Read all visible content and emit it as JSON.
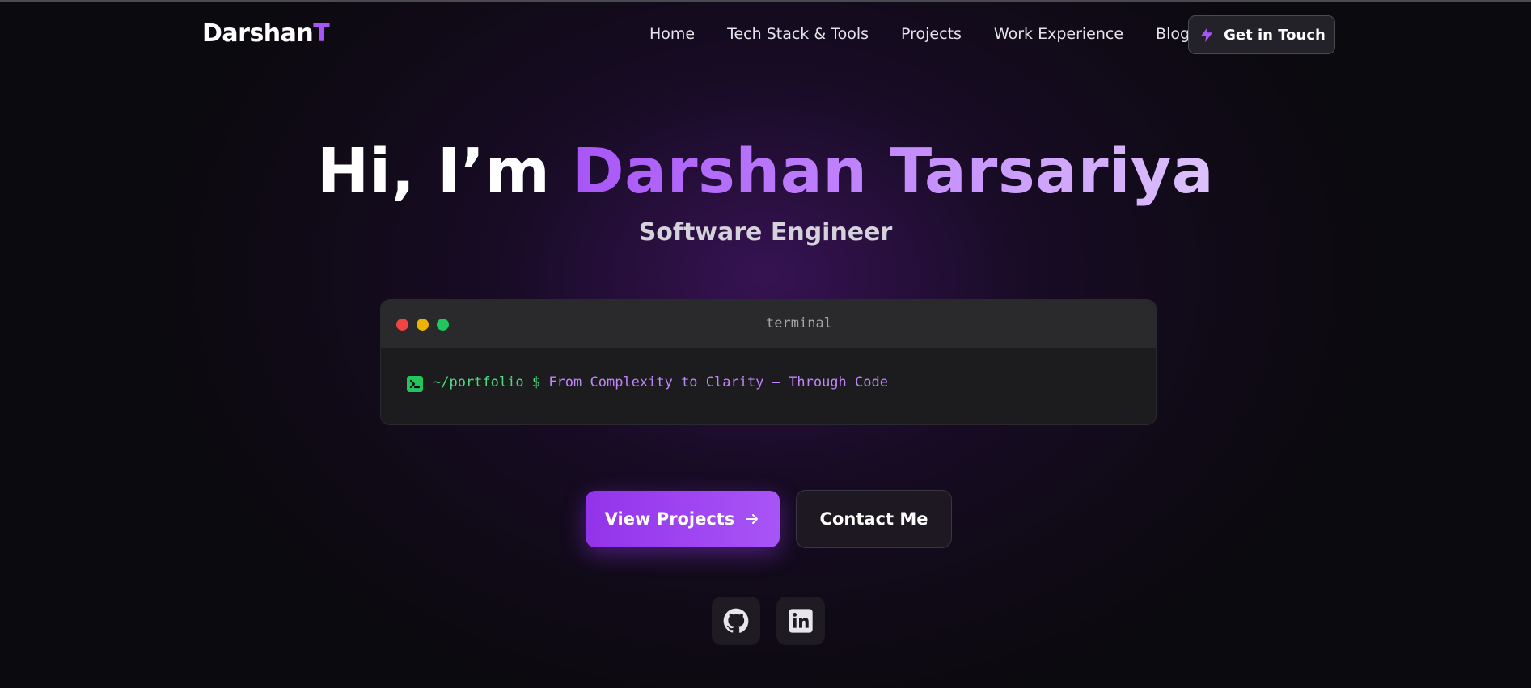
{
  "nav": {
    "logo_main": "Darshan",
    "logo_accent": "T",
    "links": [
      "Home",
      "Tech Stack & Tools",
      "Projects",
      "Work Experience",
      "Blogs"
    ],
    "cta_label": "Get in Touch",
    "cta_icon": "lightning-icon"
  },
  "hero": {
    "greeting": "Hi, I’m ",
    "name": "Darshan Tarsariya",
    "subtitle": "Software Engineer"
  },
  "terminal": {
    "title": "terminal",
    "prompt": "~/portfolio $",
    "message": "From Complexity to Clarity — Through Code",
    "icon": "terminal-icon"
  },
  "buttons": {
    "primary_label": "View Projects",
    "secondary_label": "Contact Me"
  },
  "social": {
    "github_icon": "github-icon",
    "linkedin_icon": "linkedin-icon"
  },
  "colors": {
    "accent": "#a855f7",
    "background": "#0b0a0e",
    "terminal_green": "#4ade80"
  }
}
